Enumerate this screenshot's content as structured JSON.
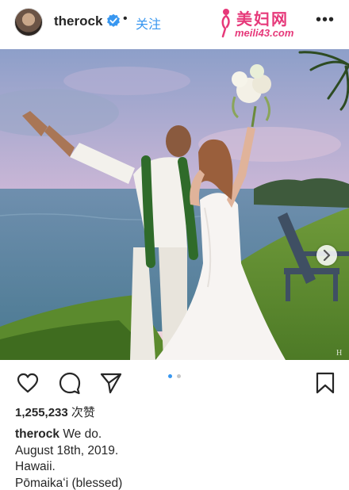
{
  "header": {
    "username": "therock",
    "separator": "•",
    "follow_label": "关注",
    "more_label": "•••",
    "verified_icon": "verified-badge-icon",
    "accent_color": "#3897f0"
  },
  "watermark": {
    "title": "美妇网",
    "url": "meili43.com",
    "color": "#e6397a"
  },
  "carousel": {
    "current_index": 1,
    "total": 2,
    "next_icon": "chevron-right-icon"
  },
  "actions": {
    "like_icon": "heart-icon",
    "comment_icon": "comment-icon",
    "share_icon": "send-icon",
    "save_icon": "bookmark-icon"
  },
  "likes": {
    "count": "1,255,233",
    "unit": "次赞"
  },
  "caption": {
    "username": "therock",
    "line1": "We do.",
    "line2": "August 18th, 2019.",
    "line3": "Hawaii.",
    "line4": "Pōmaikaʻi (blessed)"
  }
}
